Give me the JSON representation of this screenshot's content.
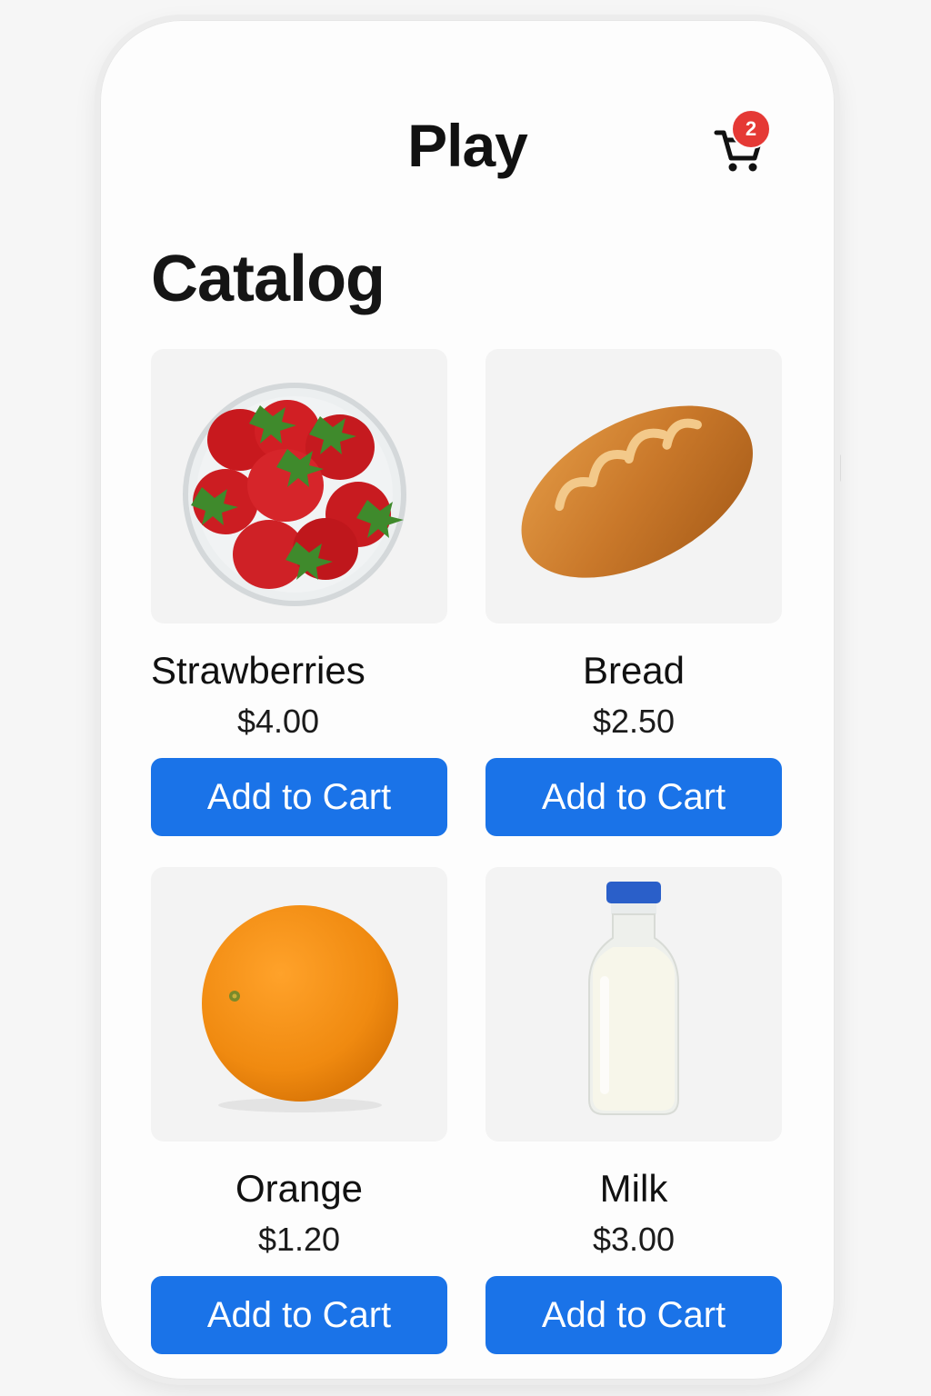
{
  "header": {
    "title": "Play",
    "cart_icon": "cart-icon",
    "cart_count": "2"
  },
  "catalog": {
    "title": "Catalog",
    "products": [
      {
        "name": "Strawberries",
        "price": "$4.00",
        "button": "Add to Cart",
        "image": "strawberries-bowl"
      },
      {
        "name": "Bread",
        "price": "$2.50",
        "button": "Add to Cart",
        "image": "bread-loaf"
      },
      {
        "name": "Orange",
        "price": "$1.20",
        "button": "Add to Cart",
        "image": "orange-fruit"
      },
      {
        "name": "Milk",
        "price": "$3.00",
        "button": "Add to Cart",
        "image": "milk-bottle"
      }
    ]
  },
  "colors": {
    "accent": "#1a73e8",
    "badge": "#e53935",
    "background": "#fdfdfd"
  }
}
